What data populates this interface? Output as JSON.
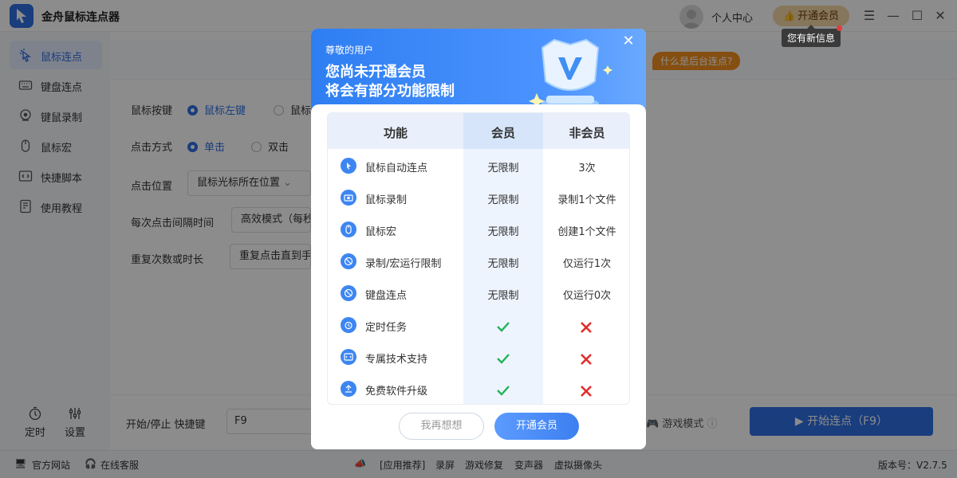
{
  "app": {
    "title": "金舟鼠标连点器"
  },
  "titlebar": {
    "personal_label": "个人中心",
    "vip_label": "开通会员",
    "tooltip": "您有新信息",
    "icons": [
      "menu-icon",
      "minimize-icon",
      "maximize-icon",
      "close-icon"
    ]
  },
  "sidebar": {
    "items": [
      {
        "label": "鼠标连点",
        "icon": "mouse-click-icon",
        "active": true
      },
      {
        "label": "键盘连点",
        "icon": "keyboard-icon"
      },
      {
        "label": "键鼠录制",
        "icon": "record-icon"
      },
      {
        "label": "鼠标宏",
        "icon": "mouse-icon"
      },
      {
        "label": "快捷脚本",
        "icon": "code-icon"
      },
      {
        "label": "使用教程",
        "icon": "tutorial-icon"
      }
    ],
    "bottom": [
      {
        "label": "定时",
        "icon": "timer-icon"
      },
      {
        "label": "设置",
        "icon": "settings-icon"
      }
    ]
  },
  "main": {
    "background_tip": "什么是后台连点?",
    "mouse_button": {
      "label": "鼠标按键",
      "options": [
        "鼠标左键",
        "鼠标"
      ],
      "selected": "鼠标左键"
    },
    "click_mode": {
      "label": "点击方式",
      "options": [
        "单击",
        "双击"
      ],
      "selected": "单击"
    },
    "click_position": {
      "label": "点击位置",
      "value": "鼠标光标所在位置"
    },
    "interval": {
      "label": "每次点击间隔时间",
      "value": "高效模式（每秒"
    },
    "repeat": {
      "label": "重复次数或时长",
      "value": "重复点击直到手"
    },
    "hotkey_label": "开始/停止 快捷键",
    "hotkey_value": "F9",
    "game_mode": "游戏模式",
    "start_button": "开始连点（F9）"
  },
  "footer": {
    "official_site": "官方网站",
    "online_service": "在线客服",
    "recommend": "[应用推荐]",
    "apps": [
      "录屏",
      "游戏修复",
      "变声器",
      "虚拟摄像头"
    ],
    "version": "版本号：V2.7.5"
  },
  "modal": {
    "greeting": "尊敬的用户",
    "title_line1": "您尚未开通会员",
    "title_line2": "将会有部分功能限制",
    "headers": {
      "feature": "功能",
      "member": "会员",
      "non_member": "非会员"
    },
    "rows": [
      {
        "feature": "鼠标自动连点",
        "icon": "mouse-click-icon",
        "member": "无限制",
        "non_member": "3次"
      },
      {
        "feature": "鼠标录制",
        "icon": "camera-icon",
        "member": "无限制",
        "non_member": "录制1个文件"
      },
      {
        "feature": "鼠标宏",
        "icon": "mouse-icon",
        "member": "无限制",
        "non_member": "创建1个文件"
      },
      {
        "feature": "录制/宏运行限制",
        "icon": "ban-icon",
        "member": "无限制",
        "non_member": "仅运行1次"
      },
      {
        "feature": "键盘连点",
        "icon": "ban-icon",
        "member": "无限制",
        "non_member": "仅运行0次"
      },
      {
        "feature": "定时任务",
        "icon": "alarm-icon",
        "member": "check",
        "non_member": "cross"
      },
      {
        "feature": "专属技术支持",
        "icon": "support-icon",
        "member": "check",
        "non_member": "cross"
      },
      {
        "feature": "免费软件升级",
        "icon": "upgrade-icon",
        "member": "check",
        "non_member": "cross"
      }
    ],
    "btn_later": "我再想想",
    "btn_vip": "开通会员"
  },
  "colors": {
    "accent": "#2f6fe4",
    "check": "#22b35c",
    "cross": "#e52b2b",
    "vip_gold": "#f5d7a6",
    "tip_orange": "#f3901f"
  }
}
